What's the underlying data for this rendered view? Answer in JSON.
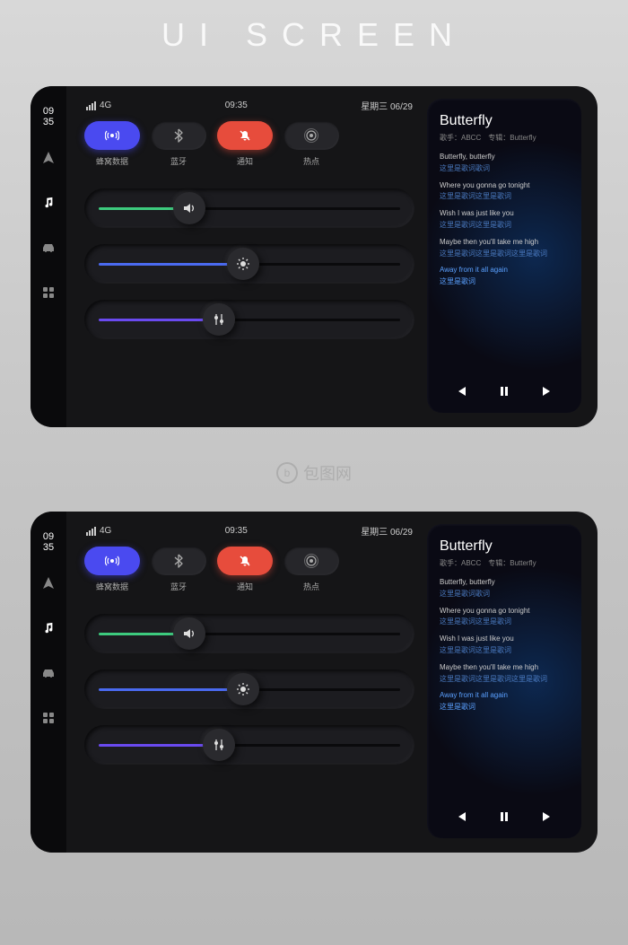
{
  "page_title": "UI SCREEN",
  "watermark": "包图网",
  "status": {
    "network": "4G",
    "time": "09:35",
    "date": "星期三  06/29"
  },
  "sidebar": {
    "time_top": "09",
    "time_bottom": "35"
  },
  "toggles": [
    {
      "label": "蜂窝数据",
      "active": true,
      "color": "blue",
      "icon": "broadcast"
    },
    {
      "label": "蓝牙",
      "active": false,
      "color": "",
      "icon": "bluetooth"
    },
    {
      "label": "通知",
      "active": true,
      "color": "red",
      "icon": "bell-off"
    },
    {
      "label": "热点",
      "active": false,
      "color": "",
      "icon": "hotspot"
    }
  ],
  "sliders": [
    {
      "name": "volume",
      "fill_color": "green",
      "percent": 30,
      "icon": "volume"
    },
    {
      "name": "brightness",
      "fill_color": "blue",
      "percent": 48,
      "icon": "brightness"
    },
    {
      "name": "equalizer",
      "fill_color": "purple",
      "percent": 40,
      "icon": "sliders"
    }
  ],
  "music": {
    "title": "Butterfly",
    "artist_label": "歌手：",
    "artist": "ABCC",
    "album_label": "专辑：",
    "album": "Butterfly",
    "lyrics": [
      {
        "en": "Butterfly, butterfly",
        "zh": "这里是歌词歌词"
      },
      {
        "en": "Where you gonna go tonight",
        "zh": "这里是歌词这里是歌词"
      },
      {
        "en": "Wish I was just like you",
        "zh": "这里是歌词这里是歌词"
      },
      {
        "en": "Maybe then you'll take me high",
        "zh": "这里是歌词这里是歌词这里是歌词"
      },
      {
        "en": "Away from it all again",
        "zh": "这里是歌词",
        "active": true
      }
    ]
  }
}
